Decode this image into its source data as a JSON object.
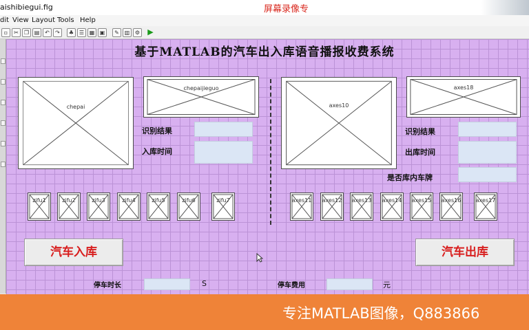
{
  "window": {
    "title": "aishibiegui.fig",
    "watermark": "屏幕录像专"
  },
  "menu": [
    {
      "label": "dit"
    },
    {
      "label": "View"
    },
    {
      "label": "Layout"
    },
    {
      "label": "Tools"
    },
    {
      "label": "Help"
    }
  ],
  "header": {
    "title": "基于MATLAB的汽车出入库语音播报收费系统"
  },
  "entry": {
    "main_axes": "chepai",
    "result_axes": "chepaijieguo",
    "char_axes": [
      "zifu1",
      "zifu2",
      "zifu3",
      "zifu4",
      "zifu5",
      "zifu6",
      "zifu7"
    ],
    "result_label": "识别结果",
    "time_label": "入库时间",
    "button": "汽车入库",
    "duration_label": "停车时长",
    "duration_unit": "S"
  },
  "exit": {
    "main_axes": "axes10",
    "result_axes": "axes18",
    "char_axes": [
      "axes11",
      "axes12",
      "axes13",
      "axes14",
      "axes15",
      "axes16",
      "axes17"
    ],
    "result_label": "识别结果",
    "time_label": "出库时间",
    "match_label": "是否库内车牌",
    "button": "汽车出库",
    "fee_label": "停车费用",
    "fee_unit": "元"
  },
  "banner": {
    "text": "专注MATLAB图像，Q883866"
  },
  "colors": {
    "canvas_bg": "#d8b0f0",
    "grid": "#bb92d6",
    "edit_bg": "#dbe6f5",
    "button_text": "#d81e1e",
    "banner": "#ef8338"
  }
}
